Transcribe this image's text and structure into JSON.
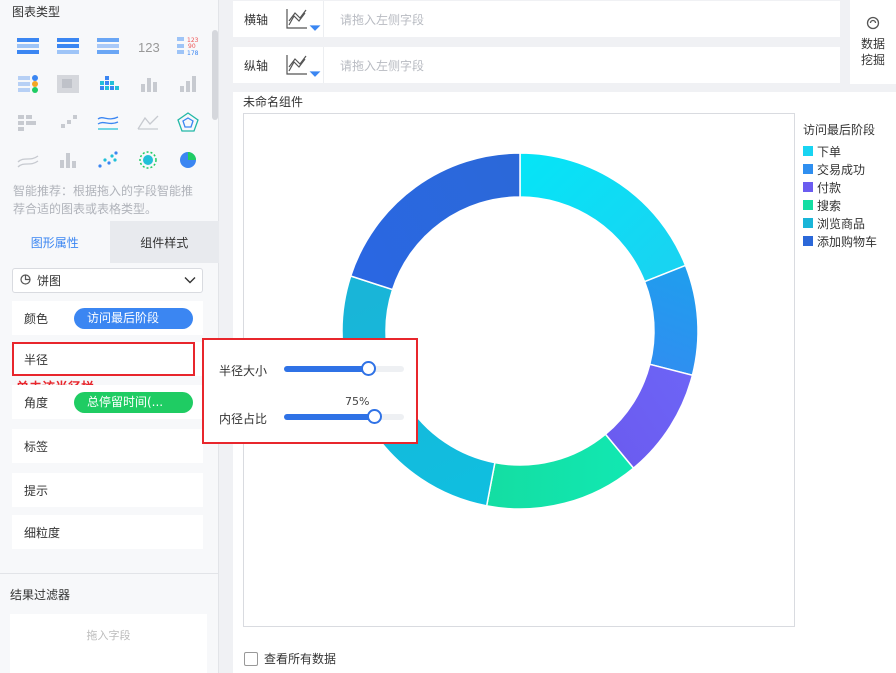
{
  "left_panel": {
    "chart_type_title": "图表类型",
    "smart_hint": "智能推荐：根据拖入的字段智能推荐合适的图表或表格类型。",
    "tabs": [
      {
        "label": "图形属性"
      },
      {
        "label": "组件样式"
      }
    ],
    "chart_select": {
      "value": "饼图"
    },
    "props": {
      "color": {
        "label": "颜色",
        "value": "访问最后阶段",
        "pill_color": "#3b86f2"
      },
      "radius": {
        "label": "半径"
      },
      "angle": {
        "label": "角度",
        "value": "总停留时间(...",
        "pill_color": "#1fcc63"
      },
      "tag": {
        "label": "标签"
      },
      "tooltip": {
        "label": "提示"
      },
      "granularity": {
        "label": "细粒度"
      }
    },
    "annotation": "单击该半径栏",
    "filter": {
      "title": "结果过滤器",
      "placeholder": "拖入字段"
    }
  },
  "axes": {
    "x": {
      "label": "横轴",
      "placeholder": "请拖入左侧字段"
    },
    "y": {
      "label": "纵轴",
      "placeholder": "请拖入左侧字段"
    }
  },
  "mining": {
    "label": "数据挖掘"
  },
  "component": {
    "title": "未命名组件",
    "view_all": "查看所有数据"
  },
  "popup": {
    "radius_label": "半径大小",
    "radius_value": 0.7,
    "inner_label": "内径占比",
    "inner_value_text": "75%",
    "inner_value": 0.75
  },
  "chart_data": {
    "type": "pie",
    "legend_title": "访问最后阶段",
    "series": [
      {
        "name": "下单",
        "value": 19,
        "color": "#05e5f7"
      },
      {
        "name": "交易成功",
        "value": 10,
        "color": "#1f9eee"
      },
      {
        "name": "付款",
        "value": 10,
        "color": "#6d64f6"
      },
      {
        "name": "搜索",
        "value": 14,
        "color": "#11e8b2"
      },
      {
        "name": "浏览商品",
        "value": 27,
        "color": "#0fbfe0"
      },
      {
        "name": "添加购物车",
        "value": 20,
        "color": "#2a67e3"
      }
    ],
    "legend_colors": [
      "#18d4f2",
      "#2f8ff0",
      "#6b5cf0",
      "#14dea3",
      "#19b5d8",
      "#2b68d9"
    ]
  }
}
